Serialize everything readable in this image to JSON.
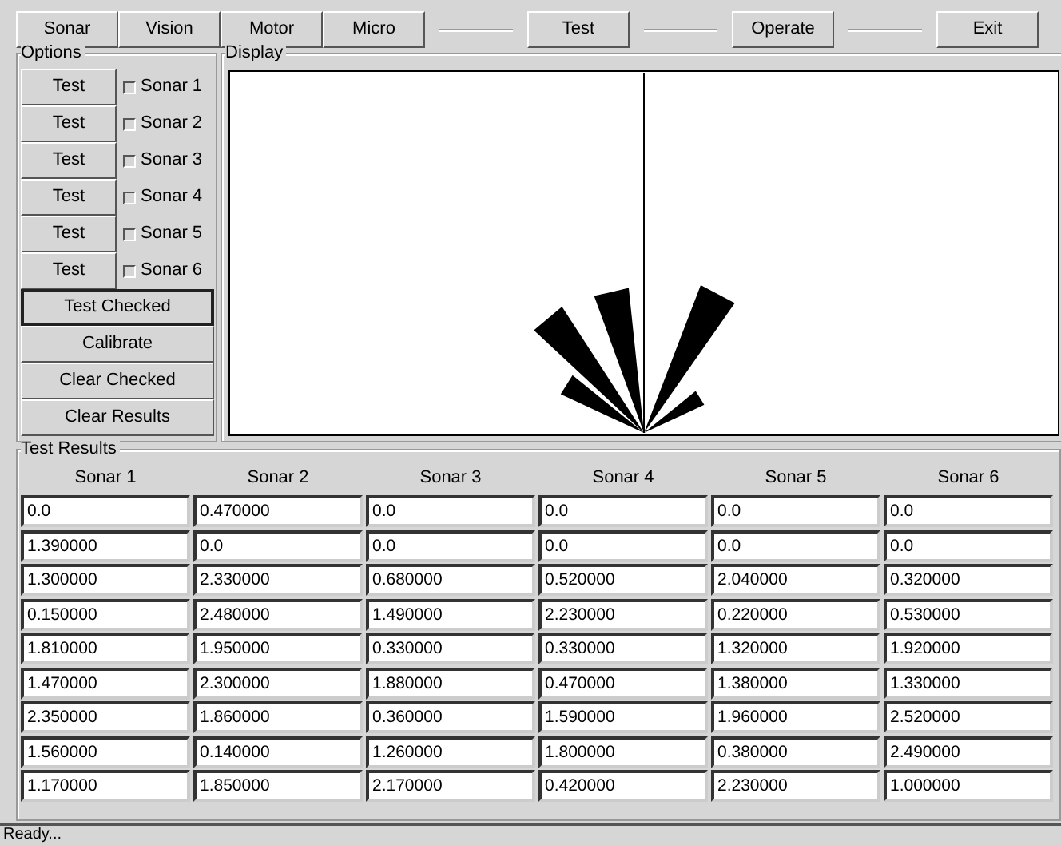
{
  "toolbar": [
    {
      "kind": "button",
      "label": "Sonar"
    },
    {
      "kind": "button",
      "label": "Vision"
    },
    {
      "kind": "button",
      "label": "Motor"
    },
    {
      "kind": "button",
      "label": "Micro"
    },
    {
      "kind": "separator"
    },
    {
      "kind": "button",
      "label": "Test"
    },
    {
      "kind": "separator"
    },
    {
      "kind": "button",
      "label": "Operate"
    },
    {
      "kind": "separator"
    },
    {
      "kind": "button",
      "label": "Exit"
    }
  ],
  "options": {
    "title": "Options",
    "sonars": [
      {
        "button": "Test",
        "label": "Sonar 1",
        "checked": false
      },
      {
        "button": "Test",
        "label": "Sonar 2",
        "checked": false
      },
      {
        "button": "Test",
        "label": "Sonar 3",
        "checked": false
      },
      {
        "button": "Test",
        "label": "Sonar 4",
        "checked": false
      },
      {
        "button": "Test",
        "label": "Sonar 5",
        "checked": false
      },
      {
        "button": "Test",
        "label": "Sonar 6",
        "checked": false
      }
    ],
    "actions": [
      {
        "label": "Test Checked",
        "selected": true
      },
      {
        "label": "Calibrate",
        "selected": false
      },
      {
        "label": "Clear Checked",
        "selected": false
      },
      {
        "label": "Clear Results",
        "selected": false
      }
    ]
  },
  "display": {
    "title": "Display"
  },
  "results": {
    "title": "Test Results",
    "columns": [
      "Sonar 1",
      "Sonar 2",
      "Sonar 3",
      "Sonar 4",
      "Sonar 5",
      "Sonar 6"
    ],
    "rows": [
      [
        "0.0",
        "0.470000",
        "0.0",
        "0.0",
        "0.0",
        "0.0"
      ],
      [
        "1.390000",
        "0.0",
        "0.0",
        "0.0",
        "0.0",
        "0.0"
      ],
      [
        "1.300000",
        "2.330000",
        "0.680000",
        "0.520000",
        "2.040000",
        "0.320000"
      ],
      [
        "0.150000",
        "2.480000",
        "1.490000",
        "2.230000",
        "0.220000",
        "0.530000"
      ],
      [
        "1.810000",
        "1.950000",
        "0.330000",
        "0.330000",
        "1.320000",
        "1.920000"
      ],
      [
        "1.470000",
        "2.300000",
        "1.880000",
        "0.470000",
        "1.380000",
        "1.330000"
      ],
      [
        "2.350000",
        "1.860000",
        "0.360000",
        "1.590000",
        "1.960000",
        "2.520000"
      ],
      [
        "1.560000",
        "0.140000",
        "1.260000",
        "1.800000",
        "0.380000",
        "2.490000"
      ],
      [
        "1.170000",
        "1.850000",
        "2.170000",
        "0.420000",
        "2.230000",
        "1.000000"
      ]
    ]
  },
  "status_bar": "Ready..."
}
